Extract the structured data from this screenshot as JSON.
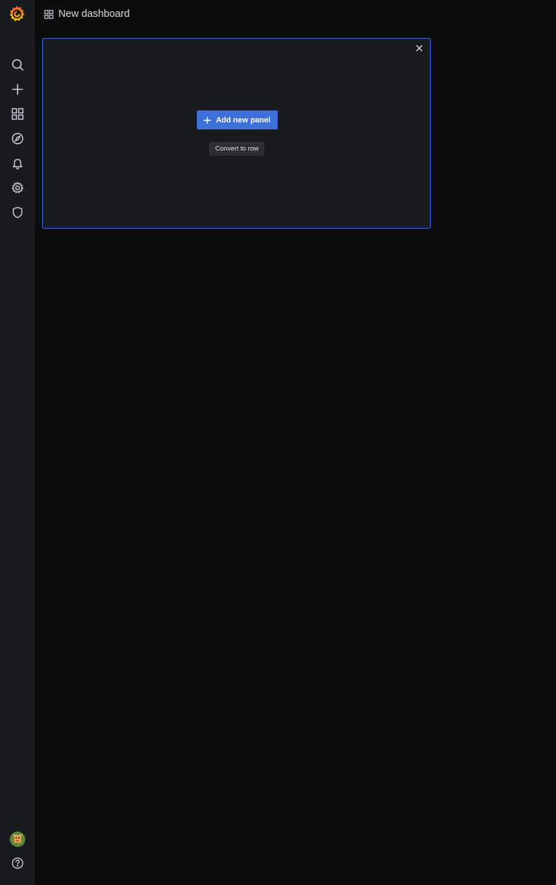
{
  "header": {
    "title": "New dashboard",
    "title_icon": "apps-icon"
  },
  "sidebar": {
    "logo": "grafana-logo",
    "items": [
      {
        "name": "search",
        "icon": "search-icon"
      },
      {
        "name": "create",
        "icon": "plus-icon"
      },
      {
        "name": "dashboards",
        "icon": "apps-icon"
      },
      {
        "name": "explore",
        "icon": "compass-icon"
      },
      {
        "name": "alerting",
        "icon": "bell-icon"
      },
      {
        "name": "configuration",
        "icon": "gear-icon"
      },
      {
        "name": "server-admin",
        "icon": "shield-icon"
      }
    ],
    "bottom": [
      {
        "name": "profile",
        "icon": "avatar"
      },
      {
        "name": "help",
        "icon": "question-circle-icon"
      }
    ]
  },
  "panel": {
    "add_button_label": "Add new panel",
    "convert_button_label": "Convert to row",
    "close_icon": "close-icon"
  },
  "colors": {
    "background": "#0b0c0e",
    "sidebar": "#181b1f",
    "panel": "#181b1f",
    "accent": "#3d71d9",
    "text": "#d8d9da",
    "icon": "#c7d0d9"
  }
}
